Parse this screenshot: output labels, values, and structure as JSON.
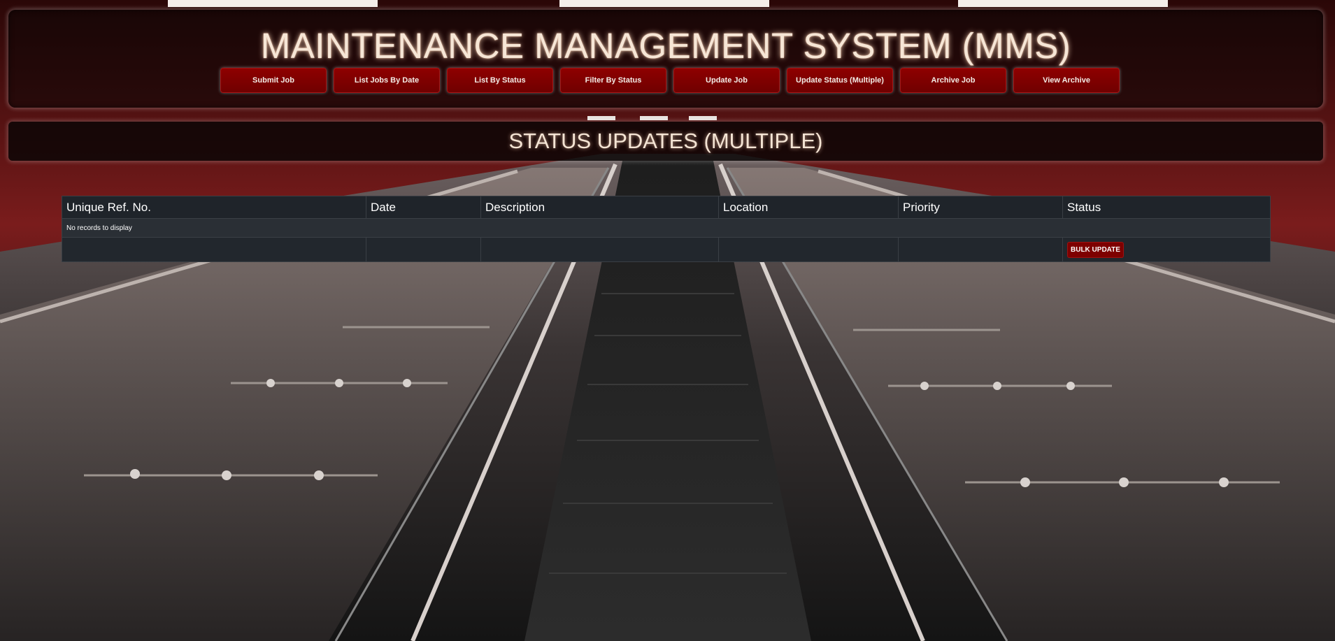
{
  "app": {
    "title": "MAINTENANCE MANAGEMENT SYSTEM (MMS)"
  },
  "nav": {
    "items": [
      {
        "label": "Submit Job"
      },
      {
        "label": "List Jobs By Date"
      },
      {
        "label": "List By Status"
      },
      {
        "label": "Filter By Status"
      },
      {
        "label": "Update Job"
      },
      {
        "label": "Update Status (Multiple)"
      },
      {
        "label": "Archive Job"
      },
      {
        "label": "View Archive"
      }
    ]
  },
  "page": {
    "title": "STATUS UPDATES (MULTIPLE)"
  },
  "table": {
    "columns": [
      "Unique Ref. No.",
      "Date",
      "Description",
      "Location",
      "Priority",
      "Status"
    ],
    "empty_message": "No records to display",
    "bulk_update_label": "BULK UPDATE"
  },
  "colors": {
    "button_red": "#7e0000",
    "title_glow": "#f6e6d6",
    "table_header_bg": "#1f242a"
  }
}
